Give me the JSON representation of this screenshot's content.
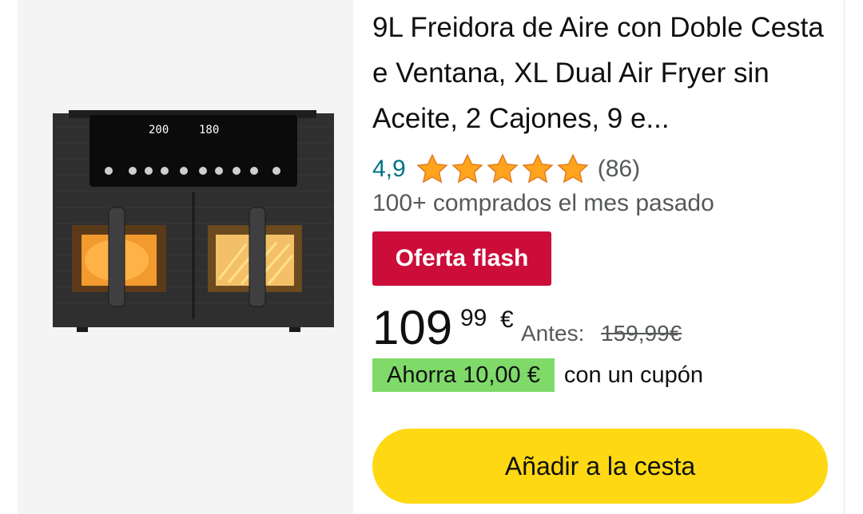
{
  "product": {
    "title": "9L Freidora de Aire con Doble Cesta e Ventana, XL Dual Air Fryer sin Aceite, 2 Cajones, 9 e...",
    "image_alt_icon": "air-fryer-product-image",
    "display_left": "200",
    "display_right": "180"
  },
  "rating": {
    "value": "4,9",
    "stars": 5,
    "review_count": "(86)"
  },
  "bought_text": "100+ comprados el mes pasado",
  "badge": {
    "label": "Oferta flash",
    "color": "#cc0c39"
  },
  "price": {
    "whole": "109",
    "fraction": "99",
    "currency": "€",
    "before_label": "Antes:",
    "before_price": "159,99€"
  },
  "coupon": {
    "badge": "Ahorra 10,00 €",
    "text": "con un cupón",
    "color": "#7fda69"
  },
  "cart_button": {
    "label": "Añadir a la cesta",
    "color": "#ffd814"
  }
}
